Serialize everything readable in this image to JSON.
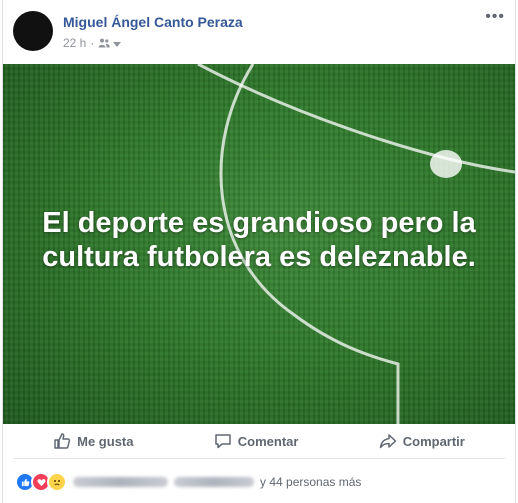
{
  "post": {
    "author": "Miguel Ángel Canto Peraza",
    "time": "22 h",
    "separator": "·",
    "more": "•••",
    "image_text": "El deporte es grandioso pero la cultura futbolera es deleznable."
  },
  "actions": {
    "like": "Me gusta",
    "comment": "Comentar",
    "share": "Compartir"
  },
  "reactions": {
    "summary_tail": "y 44 personas más",
    "types": [
      "like-icon",
      "love-icon",
      "sad-icon"
    ]
  },
  "colors": {
    "author": "#365899",
    "meta": "#90949c",
    "action_text": "#606770",
    "like": "#2078f4",
    "love": "#f33e58",
    "sad": "#fcd34b"
  }
}
